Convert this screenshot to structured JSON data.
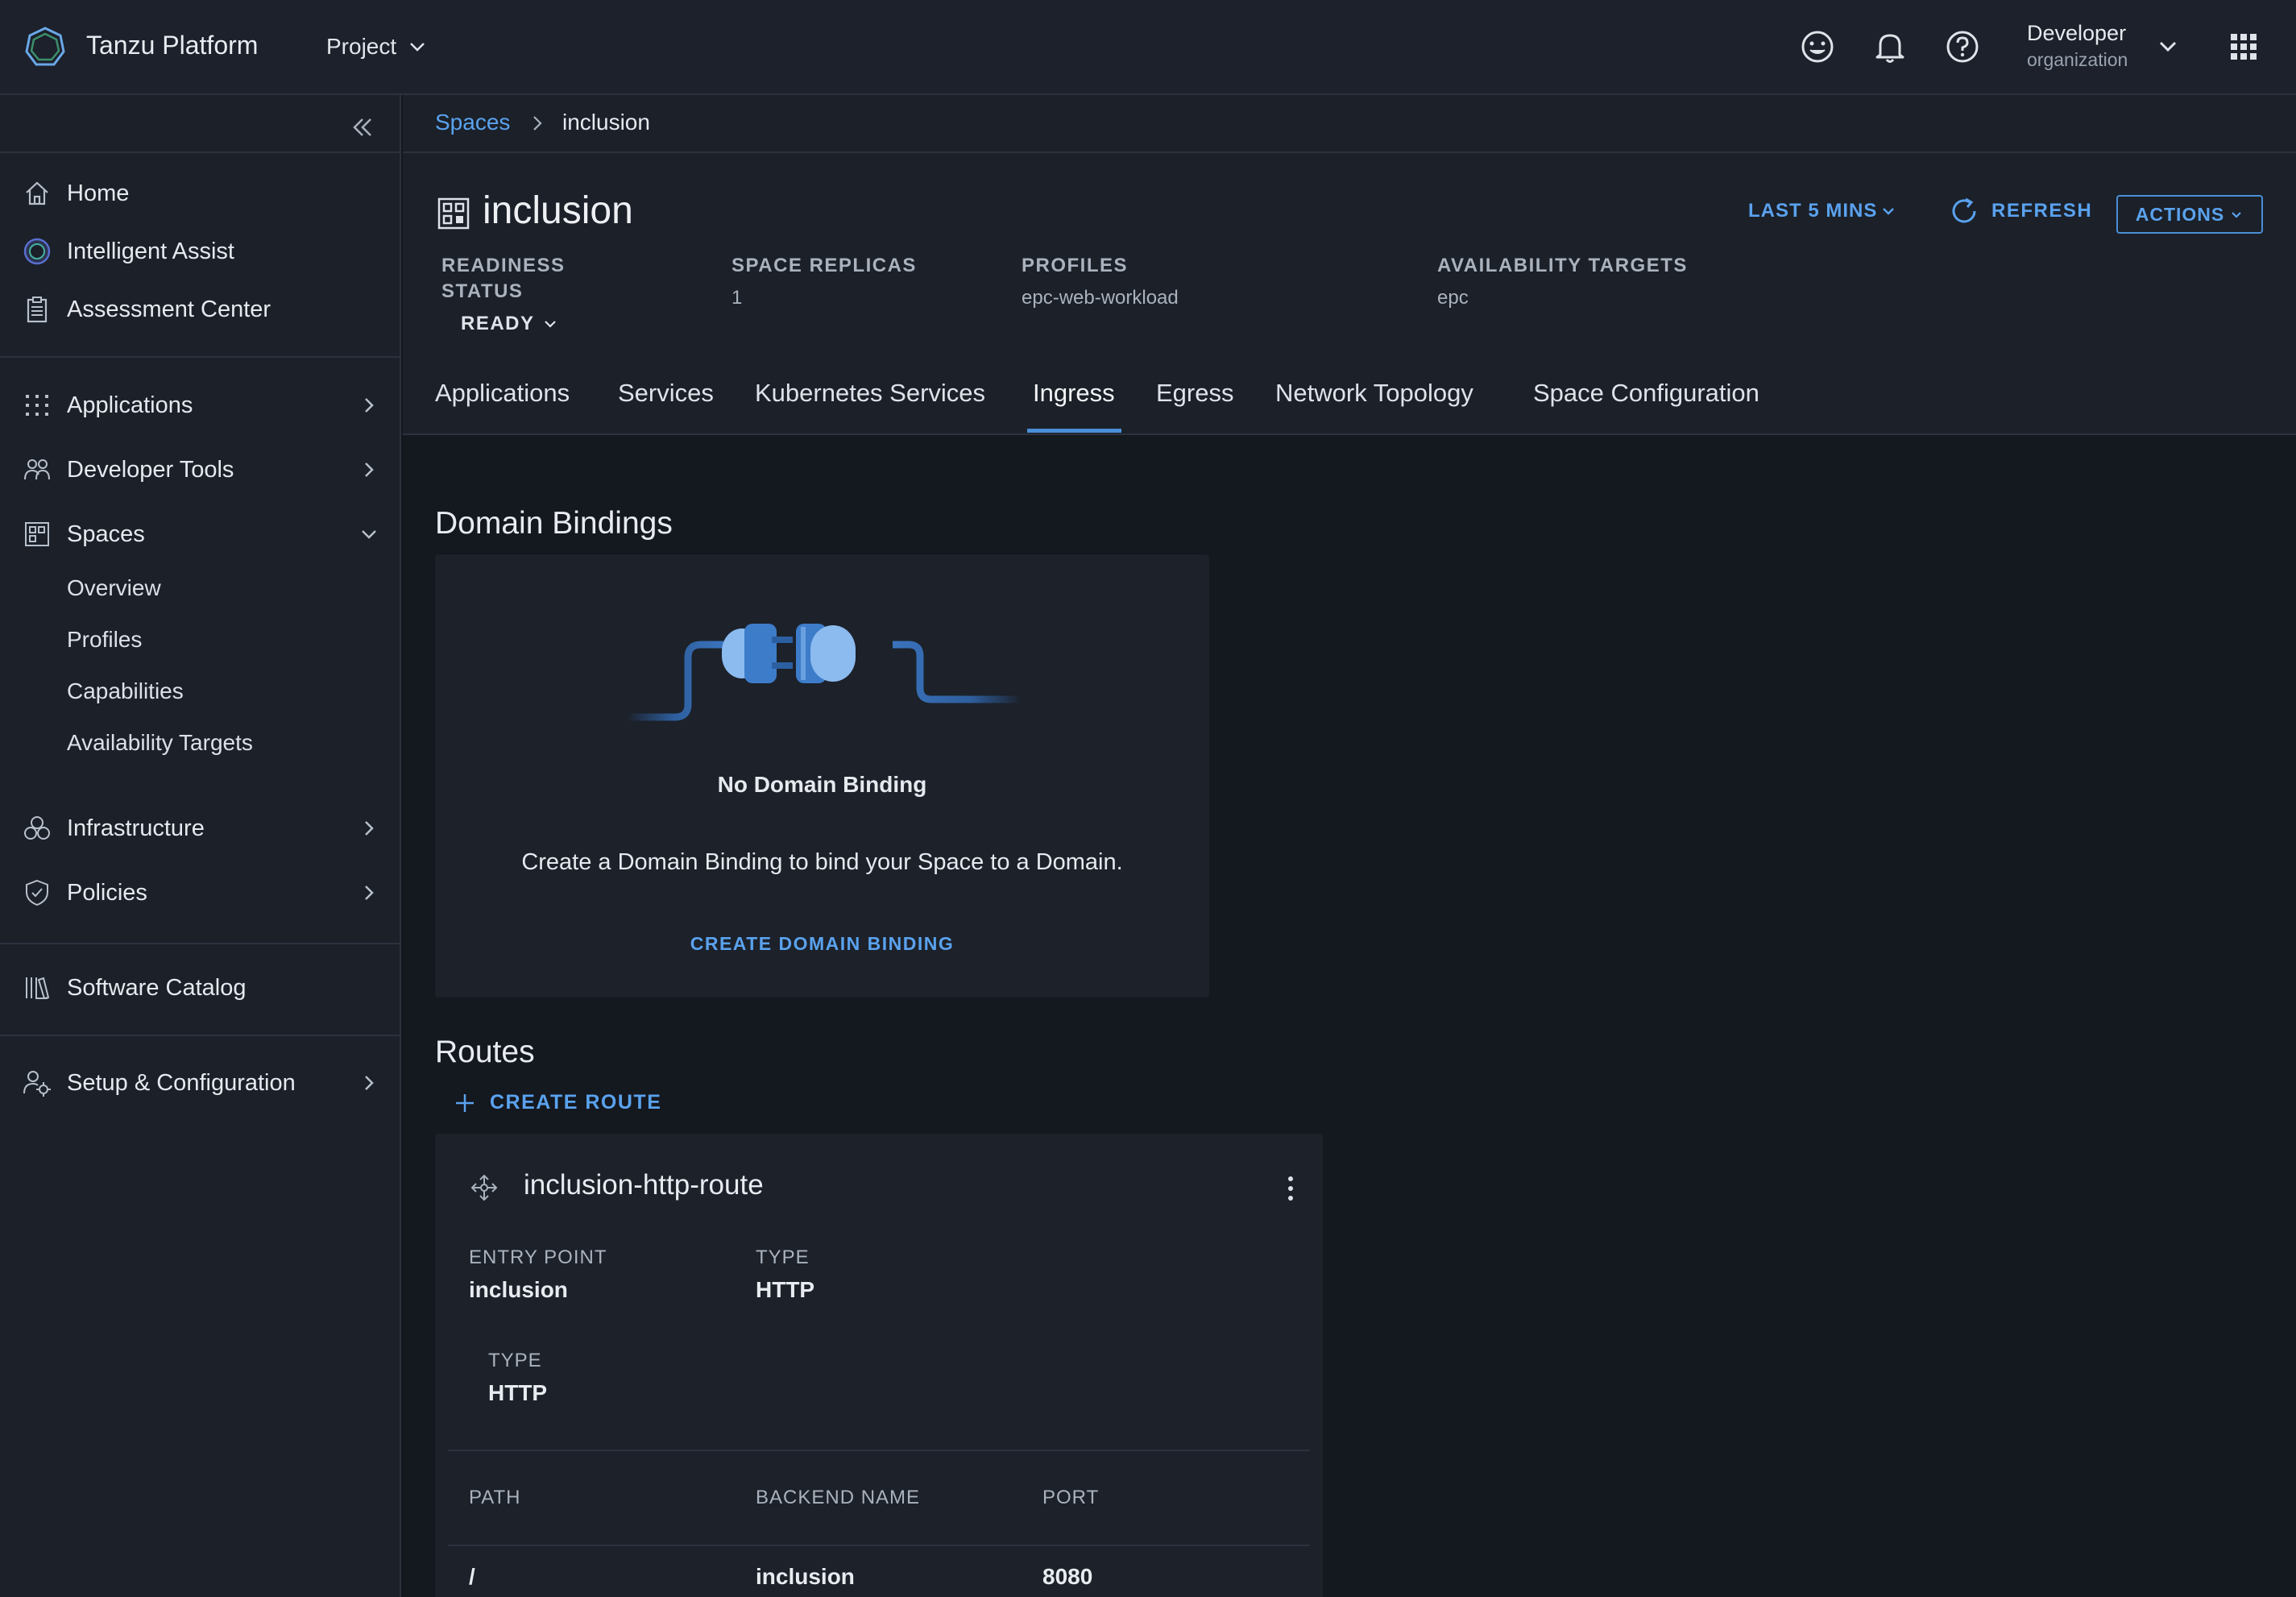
{
  "app": {
    "title": "Tanzu Platform",
    "project_label": "Project"
  },
  "header": {
    "org_name": "Developer",
    "org_sub": "organization",
    "icons": [
      "feedback-icon",
      "bell-icon",
      "help-icon",
      "apps-grid-icon"
    ]
  },
  "sidebar": {
    "top_items": [
      {
        "label": "Home",
        "icon": "home-icon"
      },
      {
        "label": "Intelligent Assist",
        "icon": "intelligent-assist-icon"
      },
      {
        "label": "Assessment Center",
        "icon": "clipboard-icon"
      }
    ],
    "mid_items": [
      {
        "label": "Applications",
        "icon": "applications-icon"
      },
      {
        "label": "Developer Tools",
        "icon": "developer-tools-icon"
      },
      {
        "label": "Spaces",
        "icon": "spaces-icon",
        "expanded": true
      }
    ],
    "spaces_sub": [
      "Overview",
      "Profiles",
      "Capabilities",
      "Availability Targets"
    ],
    "lower_items": [
      {
        "label": "Infrastructure",
        "icon": "infrastructure-icon"
      },
      {
        "label": "Policies",
        "icon": "shield-icon"
      }
    ],
    "catalog": {
      "label": "Software Catalog",
      "icon": "library-icon"
    },
    "setup": {
      "label": "Setup & Configuration",
      "icon": "user-gear-icon"
    }
  },
  "breadcrumb": {
    "parent": "Spaces",
    "current": "inclusion"
  },
  "space": {
    "title": "inclusion",
    "time_range": "LAST 5 MINS",
    "refresh_label": "REFRESH",
    "actions_label": "ACTIONS",
    "readiness_label_1": "READINESS",
    "readiness_label_2": "STATUS",
    "readiness_value": "READY",
    "replicas_label": "SPACE REPLICAS",
    "replicas_value": "1",
    "profiles_label": "PROFILES",
    "profiles_value": "epc-web-workload",
    "targets_label": "AVAILABILITY TARGETS",
    "targets_value": "epc"
  },
  "tabs": [
    {
      "label": "Applications"
    },
    {
      "label": "Services"
    },
    {
      "label": "Kubernetes Services"
    },
    {
      "label": "Ingress",
      "active": true
    },
    {
      "label": "Egress"
    },
    {
      "label": "Network Topology"
    },
    {
      "label": "Space Configuration"
    }
  ],
  "domain_bindings": {
    "title": "Domain Bindings",
    "empty_title": "No Domain Binding",
    "empty_desc": "Create a Domain Binding to bind your Space to a Domain.",
    "create_label": "CREATE DOMAIN BINDING"
  },
  "routes": {
    "title": "Routes",
    "create_label": "CREATE ROUTE",
    "items": [
      {
        "name": "inclusion-http-route",
        "entry_point_label": "ENTRY POINT",
        "entry_point_value": "inclusion",
        "type_label": "TYPE",
        "type_value": "HTTP",
        "rule_type_label": "TYPE",
        "rule_type_value": "HTTP",
        "columns": [
          "PATH",
          "BACKEND NAME",
          "PORT"
        ],
        "rows": [
          [
            "/",
            "inclusion",
            "8080"
          ]
        ]
      }
    ]
  },
  "colors": {
    "accent": "#5aa2ee",
    "background": "#14181f",
    "panel": "#1b2029"
  }
}
